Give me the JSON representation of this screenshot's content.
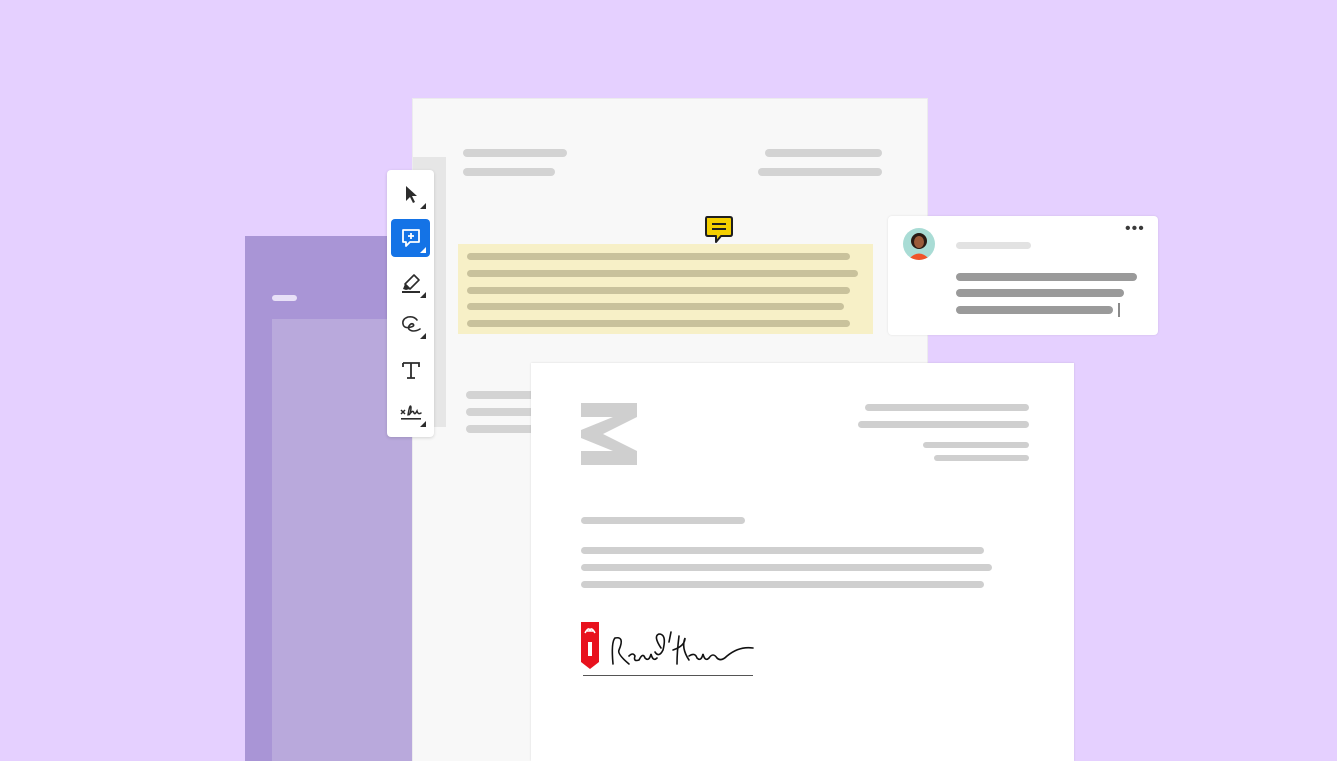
{
  "toolbar": {
    "tools": [
      {
        "name": "select",
        "icon": "cursor-arrow-icon",
        "active": false
      },
      {
        "name": "add-comment",
        "icon": "comment-add-icon",
        "active": true
      },
      {
        "name": "highlight",
        "icon": "highlighter-icon",
        "active": false
      },
      {
        "name": "draw",
        "icon": "freehand-draw-icon",
        "active": false
      },
      {
        "name": "add-text",
        "icon": "text-tool-icon",
        "active": false
      },
      {
        "name": "sign",
        "icon": "signature-icon",
        "active": false
      }
    ]
  },
  "comment": {
    "menu_label": "•••",
    "cursor": "|"
  },
  "colors": {
    "background": "#e5d0ff",
    "accent": "#1473e6",
    "highlight": "#f7f0c7",
    "comment_marker": "#f5d000",
    "acrobat_red": "#e8121e"
  }
}
